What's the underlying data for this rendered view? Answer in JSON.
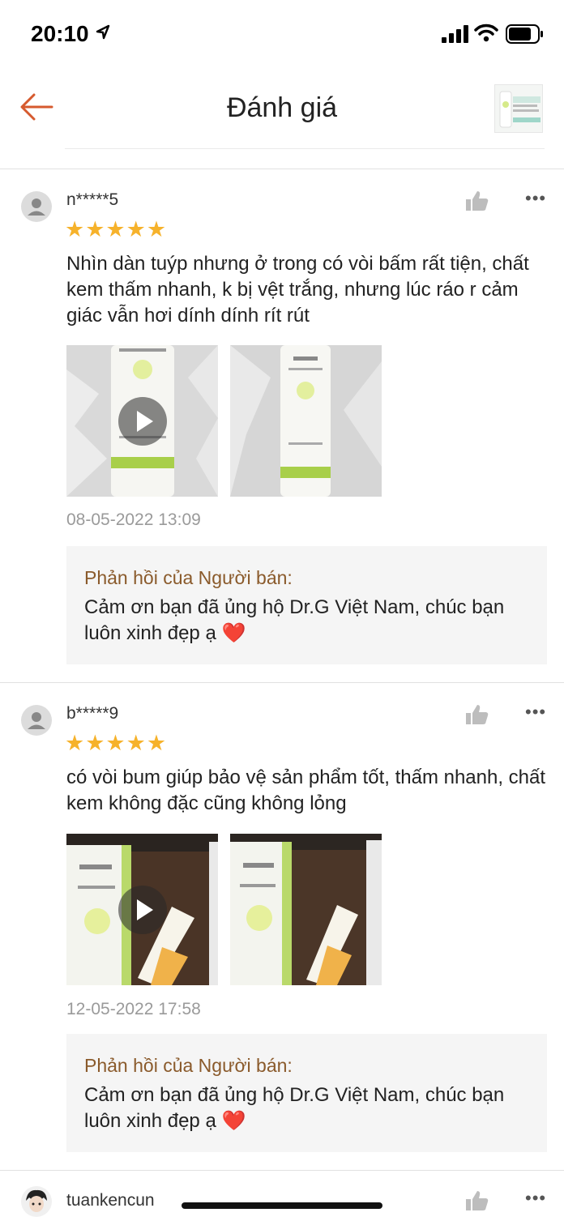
{
  "status_bar": {
    "time": "20:10"
  },
  "header": {
    "title": "Đánh giá",
    "back_icon": "arrow-left-icon",
    "accent": "#d65a2e"
  },
  "reviews": [
    {
      "username": "n*****5",
      "stars": "★★★★★",
      "comment": "Nhìn dàn tuýp nhưng ở trong có vòi bấm rất tiện, chất kem thấm nhanh, k bị vệt trắng, nhưng lúc ráo r cảm giác vẫn hơi dính dính rít rút",
      "date": "08-05-2022 13:09",
      "reply_title": "Phản hồi của Người bán:",
      "reply_text": "Cảm ơn bạn đã ủng hộ Dr.G Việt Nam, chúc bạn luôn xinh đẹp ạ ❤️"
    },
    {
      "username": "b*****9",
      "stars": "★★★★★",
      "comment": "có vòi bum giúp bảo vệ sản phẩm tốt, thấm nhanh, chất kem không đặc cũng không lỏng",
      "date": "12-05-2022 17:58",
      "reply_title": "Phản hồi của Người bán:",
      "reply_text": "Cảm ơn bạn đã ủng hộ Dr.G Việt Nam, chúc bạn luôn xinh đẹp ạ ❤️"
    },
    {
      "username": "tuankencun"
    }
  ],
  "colors": {
    "star": "#f6b22b",
    "reply_title": "#8a5a2b",
    "date": "#9a9a9a"
  }
}
